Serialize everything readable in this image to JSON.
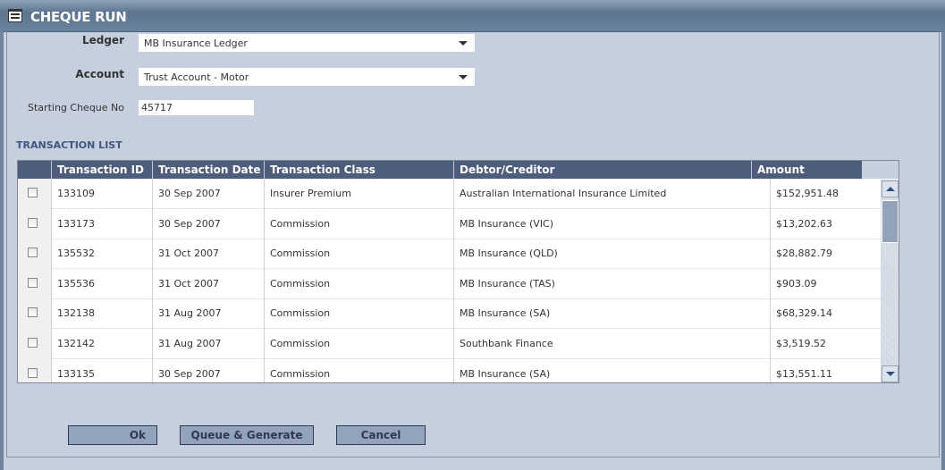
{
  "window": {
    "title": "CHEQUE RUN",
    "icon": "form-icon"
  },
  "form": {
    "ledger_label": "Ledger",
    "ledger_value": "MB Insurance Ledger",
    "account_label": "Account",
    "account_value": "Trust Account - Motor",
    "cheque_label": "Starting Cheque No",
    "cheque_value": "45717"
  },
  "transactions": {
    "title": "TRANSACTION LIST",
    "columns": [
      "Transaction ID",
      "Transaction Date",
      "Transaction Class",
      "Debtor/Creditor",
      "Amount"
    ],
    "rows": [
      {
        "id": "133109",
        "date": "30 Sep 2007",
        "cls": "Insurer Premium",
        "party": "Australian International Insurance Limited",
        "amount": "$152,951.48",
        "checked": false
      },
      {
        "id": "133173",
        "date": "30 Sep 2007",
        "cls": "Commission",
        "party": "MB Insurance (VIC)",
        "amount": "$13,202.63",
        "checked": false
      },
      {
        "id": "135532",
        "date": "31 Oct 2007",
        "cls": "Commission",
        "party": "MB Insurance (QLD)",
        "amount": "$28,882.79",
        "checked": false
      },
      {
        "id": "135536",
        "date": "31 Oct 2007",
        "cls": "Commission",
        "party": "MB Insurance (TAS)",
        "amount": "$903.09",
        "checked": false
      },
      {
        "id": "132138",
        "date": "31 Aug 2007",
        "cls": "Commission",
        "party": "MB Insurance (SA)",
        "amount": "$68,329.14",
        "checked": false
      },
      {
        "id": "132142",
        "date": "31 Aug 2007",
        "cls": "Commission",
        "party": "Southbank Finance",
        "amount": "$3,519.52",
        "checked": false
      },
      {
        "id": "133135",
        "date": "30 Sep 2007",
        "cls": "Commission",
        "party": "MB Insurance (SA)",
        "amount": "$13,551.11",
        "checked": false
      }
    ]
  },
  "buttons": {
    "ok": "Ok",
    "queue": "Queue & Generate",
    "cancel": "Cancel"
  }
}
